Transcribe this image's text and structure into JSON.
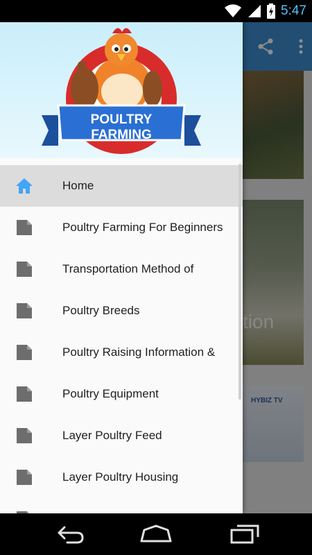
{
  "status_bar": {
    "time": "5:47"
  },
  "app": {
    "card2_text": "tion",
    "card3_text": "HYBIZ TV"
  },
  "drawer": {
    "logo_text": "POULTRY FARMING",
    "menu": [
      {
        "label": "Home",
        "icon": "home-icon",
        "active": true
      },
      {
        "label": "Poultry Farming For Beginners",
        "icon": "document-icon"
      },
      {
        "label": "Transportation Method of",
        "icon": "document-icon"
      },
      {
        "label": "Poultry Breeds",
        "icon": "document-icon"
      },
      {
        "label": "Poultry Raising Information &",
        "icon": "document-icon"
      },
      {
        "label": "Poultry Equipment",
        "icon": "document-icon"
      },
      {
        "label": "Layer Poultry Feed",
        "icon": "document-icon"
      },
      {
        "label": "Layer Poultry Housing",
        "icon": "document-icon"
      }
    ]
  },
  "colors": {
    "toolbar": "#3d8fd0",
    "home_icon": "#42a5f5",
    "doc_icon": "#6d6d6d",
    "time": "#4fc3f7"
  }
}
